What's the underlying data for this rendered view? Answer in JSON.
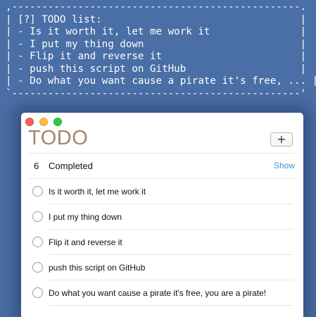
{
  "terminal": {
    "lines": [
      ",------------------------------------------------.",
      "| [?] TODO list:                                 |",
      "| - Is it worth it, let me work it               |",
      "| - I put my thing down                          |",
      "| - Flip it and reverse it                       |",
      "| - push this script on GitHub                   |",
      "| - Do what you want cause a pirate it's free, ... |",
      "`------------------------------------------------'"
    ]
  },
  "window": {
    "title": "TODO",
    "add_button_label": "+"
  },
  "completed": {
    "count": "6",
    "label": "Completed",
    "show_link": "Show"
  },
  "todos": [
    "Is it worth it, let me work it",
    "I put my thing down",
    "Flip it and reverse it",
    "push this script on GitHub",
    "Do what you want cause a pirate it's free, you are a pirate!"
  ],
  "colors": {
    "desktop_background": "#4a6da4",
    "title_color": "#a38765",
    "link_color": "#3a93d8"
  }
}
